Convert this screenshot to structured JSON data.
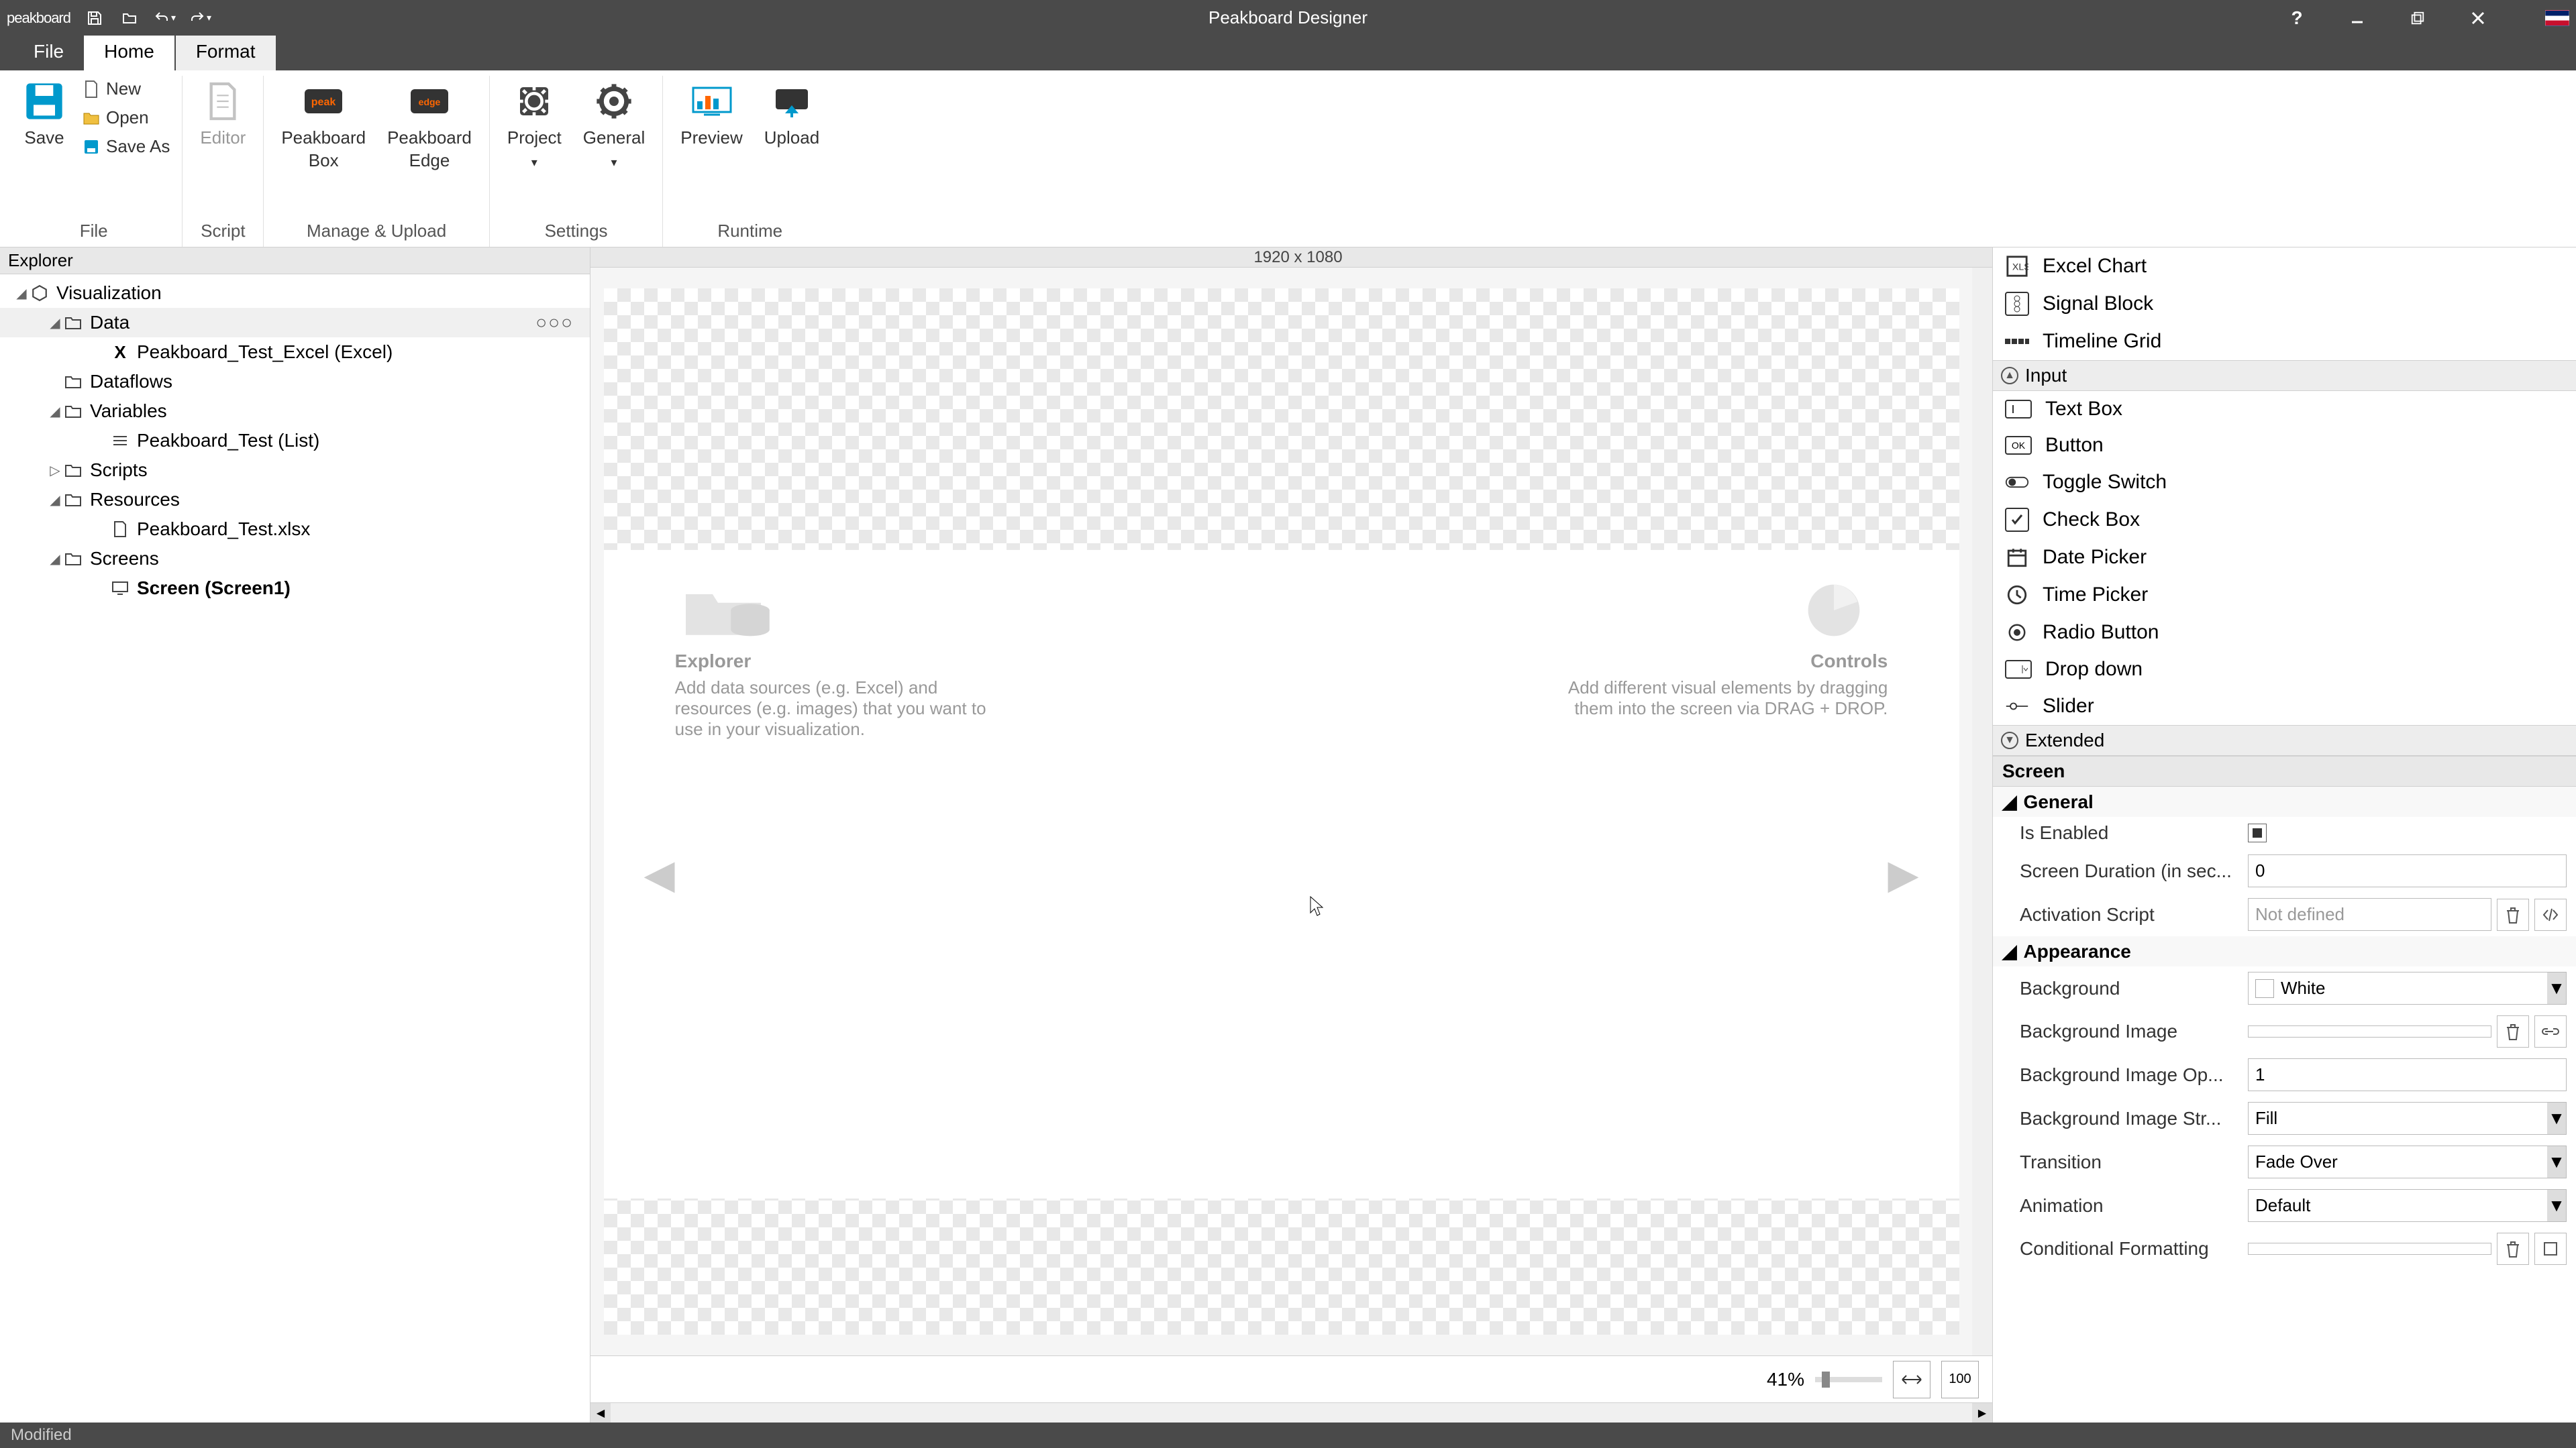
{
  "title": "Peakboard Designer",
  "logo": {
    "brand1": "peak",
    "brand2": "board"
  },
  "menutabs": {
    "file": "File",
    "home": "Home",
    "format": "Format"
  },
  "ribbon": {
    "save": "Save",
    "new": "New",
    "open": "Open",
    "saveas": "Save As",
    "editor": "Editor",
    "pbbox": "Peakboard\nBox",
    "pbedge": "Peakboard\nEdge",
    "project": "Project",
    "general": "General",
    "preview": "Preview",
    "upload": "Upload",
    "groups": {
      "file": "File",
      "script": "Script",
      "manage": "Manage & Upload",
      "settings": "Settings",
      "runtime": "Runtime"
    }
  },
  "explorer": {
    "header": "Explorer",
    "root": "Visualization",
    "data": "Data",
    "excel": "Peakboard_Test_Excel (Excel)",
    "dataflows": "Dataflows",
    "variables": "Variables",
    "varlist": "Peakboard_Test (List)",
    "scripts": "Scripts",
    "resources": "Resources",
    "resfile": "Peakboard_Test.xlsx",
    "screens": "Screens",
    "screen1": "Screen (Screen1)"
  },
  "canvas": {
    "dims": "1920 x 1080",
    "explorer_hint_title": "Explorer",
    "explorer_hint_body": "Add data sources (e.g. Excel) and resources (e.g. images) that you want to use in your visualization.",
    "controls_hint_title": "Controls",
    "controls_hint_body": "Add different visual elements by dragging them into the screen via DRAG + DROP.",
    "zoom": "41%"
  },
  "controls": {
    "excelchart": "Excel Chart",
    "signalblock": "Signal Block",
    "timelinegrid": "Timeline Grid",
    "section_input": "Input",
    "textbox": "Text Box",
    "button": "Button",
    "toggleswitch": "Toggle Switch",
    "checkbox": "Check Box",
    "datepicker": "Date Picker",
    "timepicker": "Time Picker",
    "radiobutton": "Radio Button",
    "dropdown": "Drop down",
    "slider": "Slider",
    "section_extended": "Extended"
  },
  "props": {
    "header": "Screen",
    "general": "General",
    "isenabled": "Is Enabled",
    "screenduration": "Screen Duration (in sec...",
    "screenduration_val": "0",
    "activationscript": "Activation Script",
    "activationscript_ph": "Not defined",
    "appearance": "Appearance",
    "background": "Background",
    "background_val": "White",
    "bgimage": "Background Image",
    "bgimageop": "Background Image Op...",
    "bgimageop_val": "1",
    "bgimagestr": "Background Image Str...",
    "bgimagestr_val": "Fill",
    "transition": "Transition",
    "transition_val": "Fade Over",
    "animation": "Animation",
    "animation_val": "Default",
    "condfmt": "Conditional Formatting"
  },
  "status": "Modified"
}
